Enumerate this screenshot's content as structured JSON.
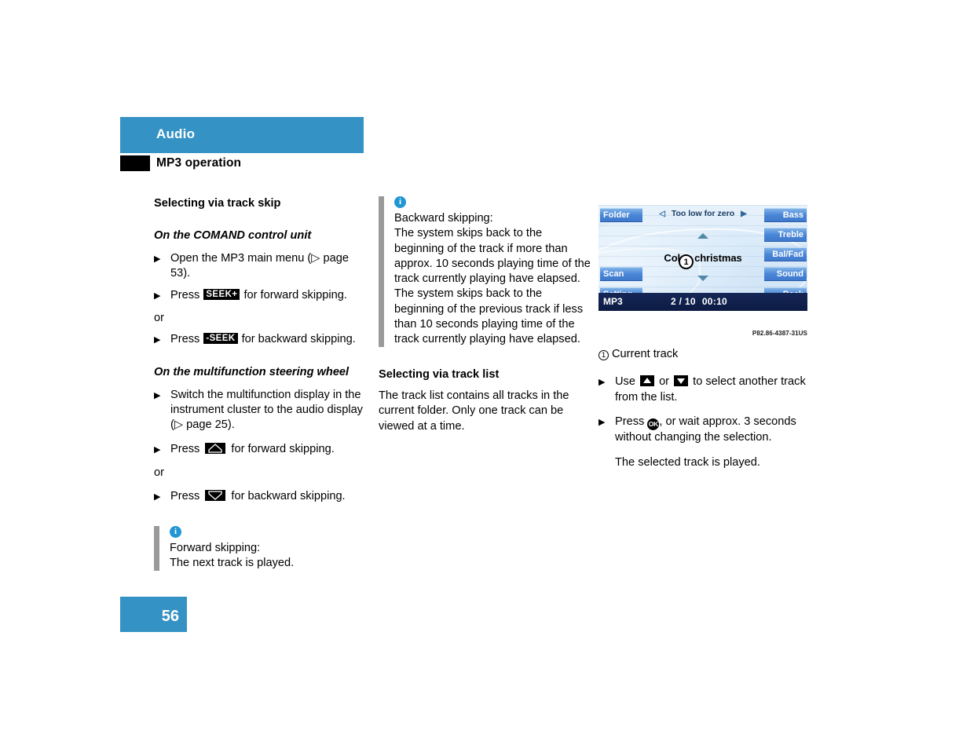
{
  "header": {
    "section": "Audio",
    "subsection": "MP3 operation",
    "accent_color": "#3592c4"
  },
  "column1": {
    "heading": "Selecting via track skip",
    "sub1": "On the COMAND control unit",
    "items1": [
      {
        "pre": "Open the MP3 main menu (▷ page 53)."
      },
      {
        "pre": "Press ",
        "key": "SEEK+",
        "post": " for forward skipping."
      }
    ],
    "or": "or",
    "items2": [
      {
        "pre": "Press ",
        "key": "-SEEK",
        "post": " for backward skipping."
      }
    ],
    "sub2": "On the multifunction steering wheel",
    "items3": [
      {
        "pre": "Switch the multifunction display in the instrument cluster to the audio display (▷ page 25)."
      },
      {
        "pre": "Press ",
        "icon": "up-arrow-key",
        "post": " for forward skipping."
      }
    ],
    "or2": "or",
    "items4": [
      {
        "pre": "Press ",
        "icon": "down-arrow-key",
        "post": " for backward skipping."
      }
    ],
    "note": {
      "icon": "info-icon",
      "lines": [
        "Forward skipping:",
        "The next track is played."
      ]
    }
  },
  "column2": {
    "note": {
      "icon": "info-icon",
      "lines": [
        "Backward skipping:",
        "The system skips back to the beginning of the track if more than approx. 10 seconds playing time of the track currently playing have elapsed.",
        "The system skips back to the beginning of the previous track if less than 10 seconds playing time of the track currently playing have elapsed."
      ]
    },
    "heading": "Selecting via track list",
    "body": "The track list contains all tracks in the current folder. Only one track can be viewed at a time."
  },
  "column3": {
    "screen": {
      "title": "Too low for zero",
      "left_arrow": "◁",
      "right_arrow": "▶",
      "left_buttons": [
        "Folder",
        "Scan",
        "Setting"
      ],
      "right_buttons": [
        "Bass",
        "Treble",
        "Bal/Fad",
        "Sound",
        "Back"
      ],
      "track_prefix": "Col",
      "track_callout": "1",
      "track_suffix": "christmas",
      "status_source": "MP3",
      "status_track": "2 / 10",
      "status_time": "00:10",
      "up_arrow_icon": "scroll-up-triangle",
      "down_arrow_icon": "scroll-down-triangle"
    },
    "figure_code": "P82.86-4387-31US",
    "legend": {
      "num": "1",
      "label": "Current track"
    },
    "items": [
      {
        "pre": "Use ",
        "icon1": "up-arrow-key",
        "mid": " or ",
        "icon2": "down-arrow-key",
        "post": " to select another track from the list."
      },
      {
        "pre": "Press ",
        "okkey": "OK",
        "post": ", or wait approx. 3 seconds without changing the selection."
      }
    ],
    "closing": "The selected track is played."
  },
  "footer": {
    "page_number": "56"
  }
}
